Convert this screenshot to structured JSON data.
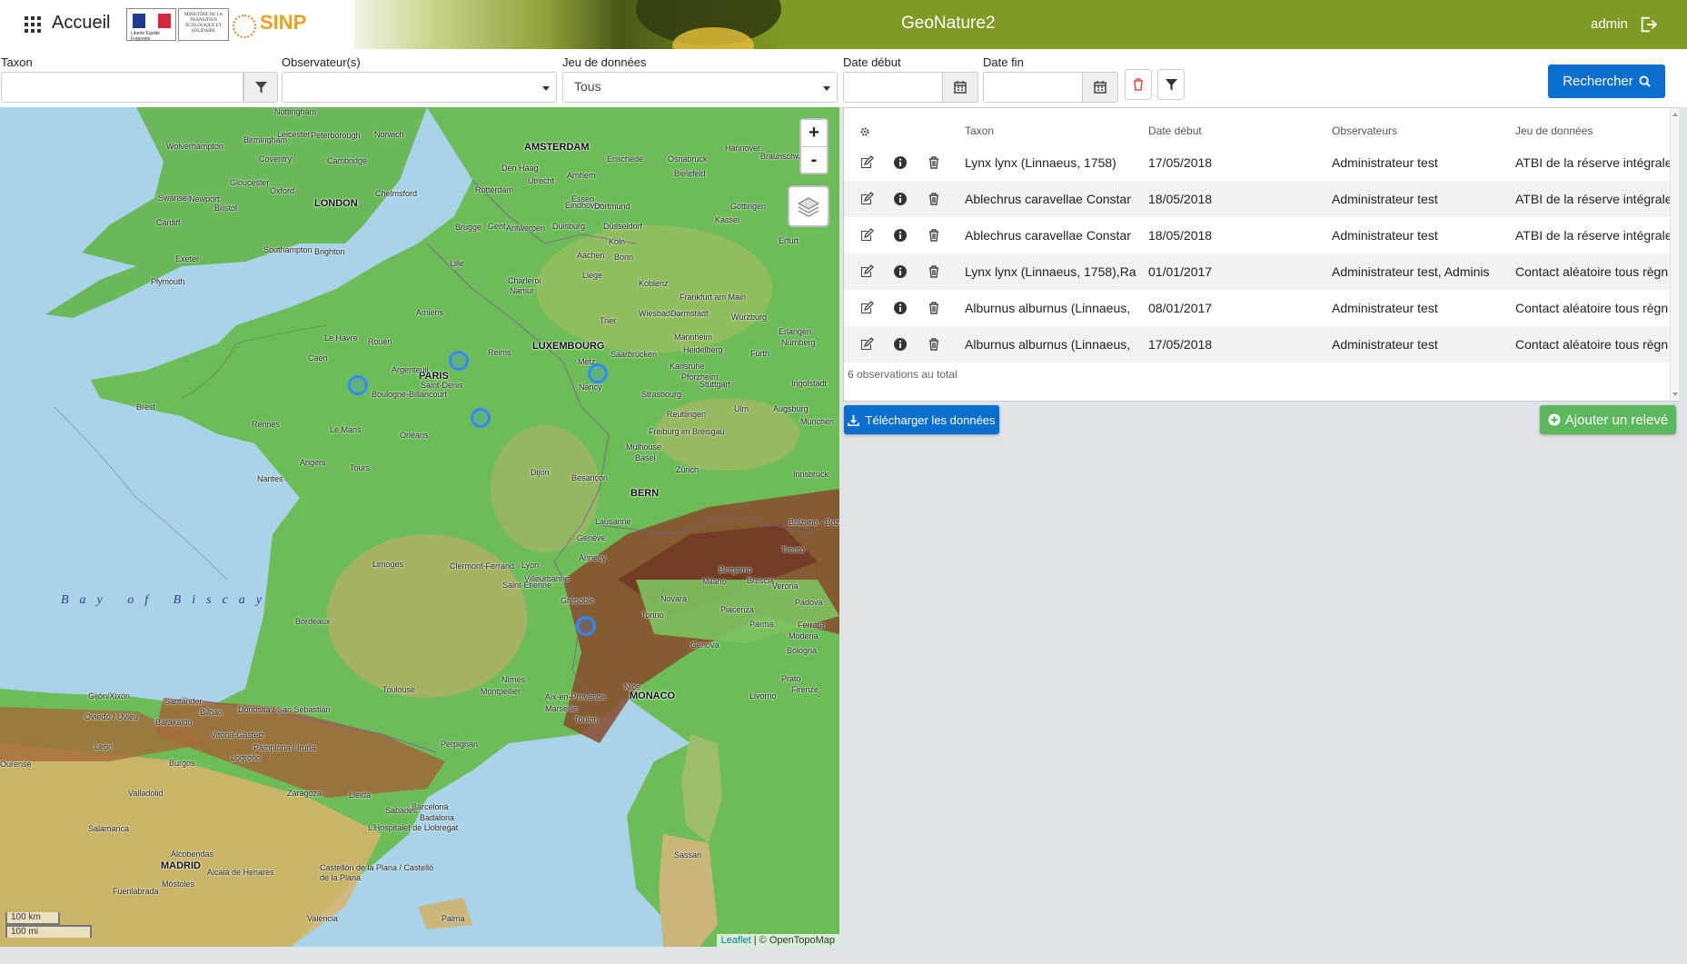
{
  "header": {
    "home_label": "Accueil",
    "app_title": "GeoNature2",
    "user": "admin",
    "logo_sinp": "SINP",
    "logo_ministry": "MINISTÈRE DE LA TRANSITION ÉCOLOGIQUE ET SOLIDAIRE",
    "icons": {
      "apps": "apps-grid-icon",
      "logout": "logout-icon"
    },
    "colors": {
      "header_bg": "#7f9a25",
      "primary": "#0a6ecf",
      "success": "#5cb85c"
    }
  },
  "filters": {
    "taxon_label": "Taxon",
    "taxon_value": "",
    "observers_label": "Observateur(s)",
    "observers_value": "",
    "dataset_label": "Jeu de données",
    "dataset_value": "Tous",
    "date_start_label": "Date début",
    "date_start_value": "",
    "date_end_label": "Date fin",
    "date_end_value": "",
    "search_label": "Rechercher"
  },
  "map": {
    "zoom_in": "+",
    "zoom_out": "-",
    "scale_km": "100 km",
    "scale_mi": "100 mi",
    "attribution_link": "Leaflet",
    "attribution_text": "| © OpenTopoMap",
    "sea_label": "Bay of Biscay",
    "capitals": [
      "LONDON",
      "AMSTERDAM",
      "PARIS",
      "LUXEMBOURG",
      "BERN",
      "MONACO",
      "MADRID"
    ],
    "cities": [
      "Birmingham",
      "Nottingham",
      "Leicester",
      "Peterborough",
      "Norwich",
      "Wolverhampton",
      "Coventry",
      "Cambridge",
      "Gloucester",
      "Oxford",
      "Chelmsford",
      "Swansea",
      "Newport",
      "Bristol",
      "Cardiff",
      "Exeter",
      "Southampton",
      "Brighton",
      "Plymouth",
      "Den Haag",
      "Rotterdam",
      "Utrecht",
      "Arnhem",
      "Enschede",
      "Osnabrück",
      "Bielefeld",
      "Hannover",
      "Braunschweig",
      "Brugge",
      "Gent",
      "Antwerpen",
      "Eindhoven",
      "Duisburg",
      "Düsseldorf",
      "Essen",
      "Dortmund",
      "Köln",
      "Bonn",
      "Aachen",
      "Liège",
      "Lille",
      "Charleroi",
      "Namur",
      "Koblenz",
      "Kassel",
      "Göttingen",
      "Erfurt",
      "Frankfurt am Main",
      "Wiesbaden",
      "Darmstadt",
      "Würzburg",
      "Trier",
      "Mannheim",
      "Heidelberg",
      "Nürnberg",
      "Erlangen",
      "Fürth",
      "Karlsruhe",
      "Pforzheim",
      "Stuttgart",
      "Ingolstadt",
      "Saarbrücken",
      "Metz",
      "Nancy",
      "Strasbourg",
      "Reutlingen",
      "Ulm",
      "Augsburg",
      "München",
      "Freiburg im Breisgau",
      "Mulhouse",
      "Basel",
      "Zürich",
      "Innsbruck",
      "Reims",
      "Amiens",
      "Rouen",
      "Le Havre",
      "Caen",
      "Argenteuil",
      "Saint-Denis",
      "Boulogne-Billancourt",
      "Brest",
      "Rennes",
      "Le Mans",
      "Orléans",
      "Angers",
      "Nantes",
      "Tours",
      "Dijon",
      "Besançon",
      "Lausanne",
      "Genève",
      "Annecy",
      "Limoges",
      "Clermont-Ferrand",
      "Lyon",
      "Villeurbanne",
      "Saint-Étienne",
      "Grenoble",
      "Bergamo",
      "Milano",
      "Brescia",
      "Verona",
      "Padova",
      "Trento",
      "Bolzano - Bozen",
      "Novara",
      "Torino",
      "Piacenza",
      "Parma",
      "Modena",
      "Bologna",
      "Ferrara",
      "Genova",
      "Prato",
      "Firenze",
      "Livorno",
      "Bordeaux",
      "Toulouse",
      "Nîmes",
      "Montpellier",
      "Aix-en-Provence",
      "Marseille",
      "Toulon",
      "Nice",
      "Santander",
      "Bilbao",
      "Barakaldo",
      "Gijón/Xixón",
      "Oviedo / Uviéu",
      "Donostia / San Sebastián",
      "Vitoria-Gasteiz",
      "Pamplona / Iruña",
      "Perpignan",
      "León",
      "Burgos",
      "Logroño",
      "Valladolid",
      "Zaragoza",
      "Lleida",
      "Barcelona",
      "Badalona",
      "Sabadell",
      "L'Hospitalet de Llobregat",
      "Salamanca",
      "Alcobendas",
      "Alcalá de Henares",
      "Móstoles",
      "Fuenlabrada",
      "Castellón de la Plana / Castelló de la Plana",
      "Palma",
      "València",
      "Sassari",
      "Ourense"
    ]
  },
  "table": {
    "columns": [
      "Taxon",
      "Date début",
      "Observateurs",
      "Jeu de données"
    ],
    "settings_icon": "gear-icon",
    "rows": [
      {
        "taxon": "Lynx lynx (Linnaeus, 1758)",
        "date": "17/05/2018",
        "observers": "Administrateur test",
        "dataset": "ATBI de la réserve intégrale"
      },
      {
        "taxon": "Ablechrus caravellae Constar",
        "date": "18/05/2018",
        "observers": "Administrateur test",
        "dataset": "ATBI de la réserve intégrale"
      },
      {
        "taxon": "Ablechrus caravellae Constar",
        "date": "18/05/2018",
        "observers": "Administrateur test",
        "dataset": "ATBI de la réserve intégrale"
      },
      {
        "taxon": "Lynx lynx (Linnaeus, 1758),Ra",
        "date": "01/01/2017",
        "observers": "Administrateur test, Adminis",
        "dataset": "Contact aléatoire tous règn"
      },
      {
        "taxon": "Alburnus alburnus (Linnaeus,",
        "date": "08/01/2017",
        "observers": "Administrateur test",
        "dataset": "Contact aléatoire tous règn"
      },
      {
        "taxon": "Alburnus alburnus (Linnaeus,",
        "date": "17/05/2018",
        "observers": "Administrateur test",
        "dataset": "Contact aléatoire tous règn"
      }
    ],
    "footer": "6 observations au total"
  },
  "actions": {
    "download_label": "Télécharger les données",
    "add_label": "Ajouter un relevé"
  }
}
